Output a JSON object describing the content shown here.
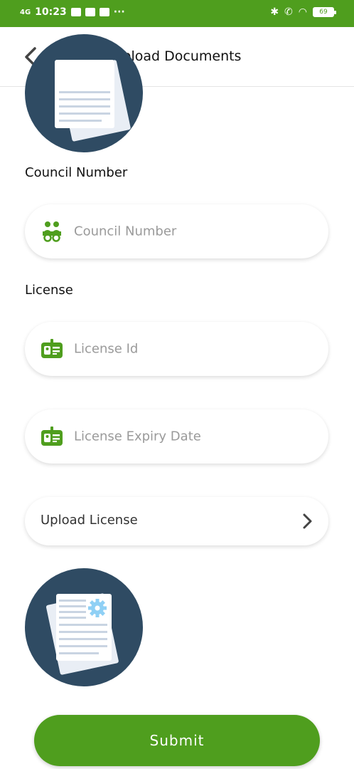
{
  "status_bar": {
    "network": "4G",
    "time": "10:23",
    "more": "···",
    "battery": "69"
  },
  "header": {
    "title": "Upload Documents"
  },
  "council": {
    "label": "Council Number",
    "placeholder": "Council Number",
    "icon": "people-icon"
  },
  "license": {
    "label": "License",
    "id_placeholder": "License Id",
    "expiry_placeholder": "License Expiry Date",
    "icon": "id-card-icon"
  },
  "upload": {
    "label": "Upload License"
  },
  "submit": {
    "label": "Submit"
  },
  "colors": {
    "brand_green": "#4f9e1e",
    "navy_circle": "#2f4b63",
    "settings_blue": "#8fd0f5"
  }
}
